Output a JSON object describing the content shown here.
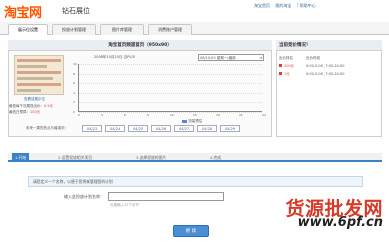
{
  "brand": {
    "logo": "淘宝网",
    "product": "钻石展位"
  },
  "top_nav": [
    "淘宝首页",
    "我的淘宝",
    "帮助中心"
  ],
  "tabs": [
    {
      "label": "展示位设置",
      "active": true
    },
    {
      "label": "投放计划管理",
      "active": false
    },
    {
      "label": "图片库管理",
      "active": false
    },
    {
      "label": "消费账户管理",
      "active": false
    }
  ],
  "position": {
    "title": "淘宝首页频道首页（950x90）",
    "preview_label": "查看该展示位",
    "min_bid_label": "最低每千次展现出价：",
    "min_bid_value": "0.5元",
    "min_daily_label": "最低日预算：",
    "min_daily_value": "100元",
    "date_caption": "2008年10月20日-当PV/5",
    "range_select": "08/10/20 星期一(最新",
    "legend": "流量预估"
  },
  "chart_data": {
    "type": "line",
    "x": [
      0,
      3,
      6,
      9,
      12,
      15,
      18,
      21,
      24
    ],
    "y_ticks": [
      10,
      8,
      6,
      4,
      2,
      0
    ],
    "ylim": [
      0,
      10
    ],
    "series": []
  },
  "dates": {
    "label": "未来一周的热点与增减况：",
    "items": [
      "04/23",
      "04/24",
      "04/25",
      "04/26",
      "04/27",
      "04/28",
      "04/29"
    ]
  },
  "summary": {
    "title": "当前竞价情况！",
    "col1": "出价排名",
    "col2": "出价时段",
    "rows": [
      {
        "amount": "200元",
        "time": "0:00-0:00 ,7:00-24:00"
      },
      {
        "amount": "1元",
        "time": "0:00-0:00 ,7:00-24:00"
      }
    ]
  },
  "steps": [
    "1.开始",
    "2.设置投放相关项目",
    "3.选择投放的图片",
    "4.完成"
  ],
  "form": {
    "info": "请您定义一个名称，以便于您将来管理您的计划",
    "name_label": "输入此投放计划名称：",
    "hint": "长度输入32个字节",
    "next_button": "继 续"
  },
  "watermark": {
    "text": "货源批发网",
    "url": "www.6pf.cn"
  }
}
